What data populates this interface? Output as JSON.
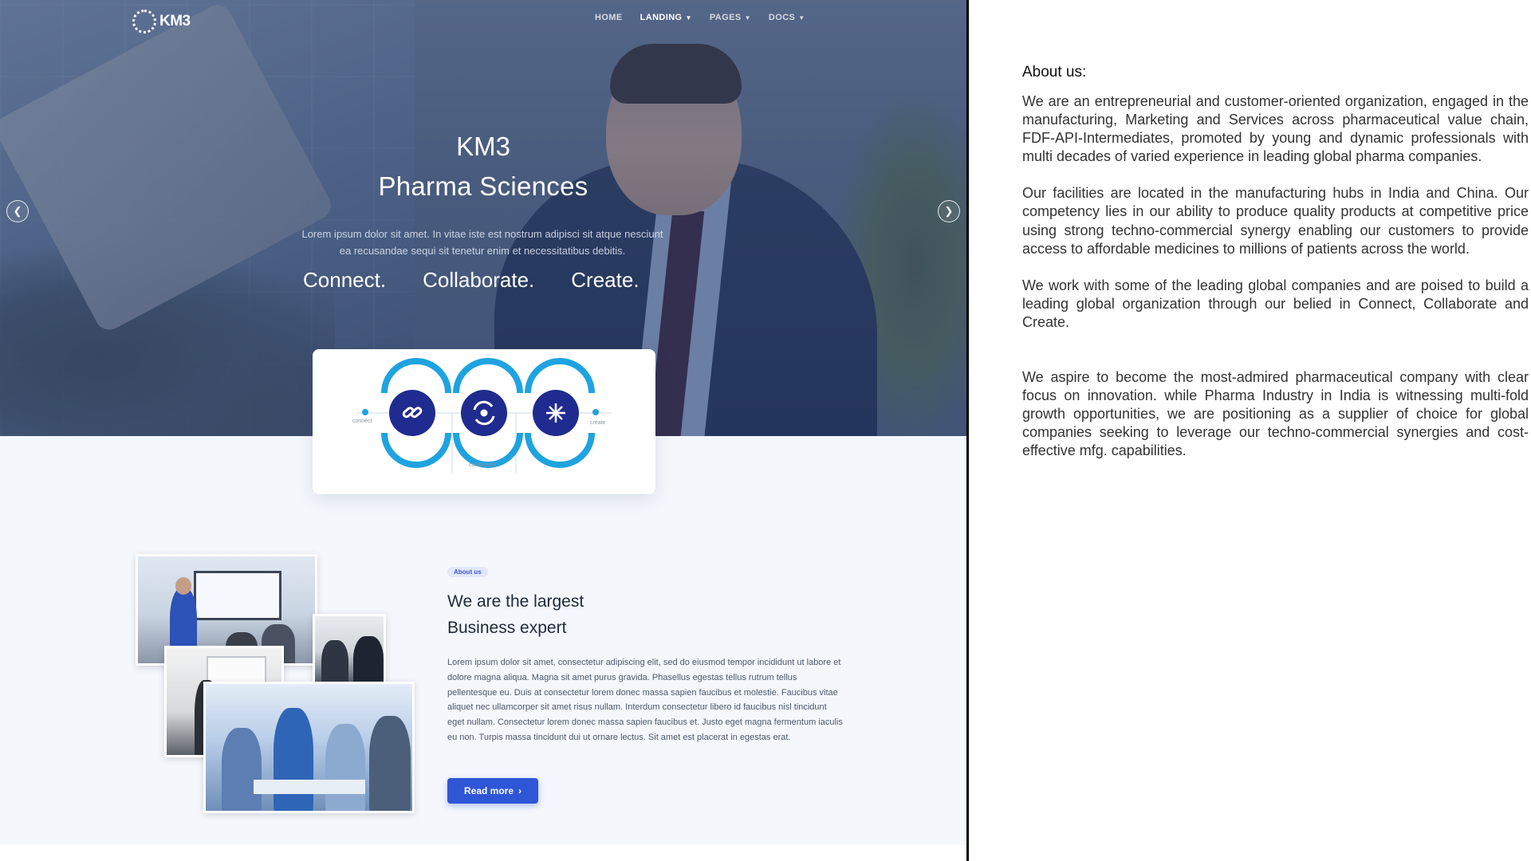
{
  "site": {
    "logo": "KM3",
    "nav": [
      {
        "label": "HOME",
        "has_dropdown": false,
        "active": false
      },
      {
        "label": "LANDING",
        "has_dropdown": true,
        "active": true
      },
      {
        "label": "PAGES",
        "has_dropdown": true,
        "active": false
      },
      {
        "label": "DOCS",
        "has_dropdown": true,
        "active": false
      }
    ],
    "hero": {
      "brand": "KM3",
      "title": "Pharma Sciences",
      "description": "Lorem ipsum dolor sit amet. In vitae iste est nostrum adipisci sit atque nesciunt ea recusandae sequi sit tenetur enim et necessitatibus debitis.",
      "tagline": [
        "Connect.",
        "Collaborate.",
        "Create."
      ],
      "prev_icon": "chevron-left-icon",
      "next_icon": "chevron-right-icon"
    },
    "feature_card": {
      "labels": {
        "left": "connect",
        "middle": "collaborate",
        "right": "create"
      },
      "icons": [
        "chain-link-icon",
        "recycle-arrows-icon",
        "sparkle-icon"
      ],
      "ring_color": "#1fa3e0",
      "circle_color": "#1f2b8f"
    },
    "about": {
      "badge": "About us",
      "heading_line1": "We are the largest",
      "heading_line2": "Business expert",
      "body": "Lorem ipsum dolor sit amet, consectetur adipiscing elit, sed do eiusmod tempor incididunt ut labore et dolore magna aliqua. Magna sit amet purus gravida. Phasellus egestas tellus rutrum tellus pellentesque eu. Duis at consectetur lorem donec massa sapien faucibus et molestie. Faucibus vitae aliquet nec ullamcorper sit amet risus nullam. Interdum consectetur libero id faucibus nisl tincidunt eget nullam. Consectetur lorem donec massa sapien faucibus et. Justo eget magna fermentum iaculis eu non. Turpis massa tincidunt dui ut ornare lectus. Sit amet est placerat in egestas erat.",
      "button_label": "Read more",
      "button_icon": "chevron-right-icon",
      "accent_color": "#2f56d6"
    }
  },
  "about_text": {
    "label": "About us:",
    "paragraphs": [
      "We are an entrepreneurial and customer-oriented organization, engaged in the manufacturing, Marketing and Services across pharmaceutical value chain, FDF-API-Intermediates, promoted by young and dynamic professionals with multi decades of varied experience in leading global pharma companies.",
      "Our facilities are located in the manufacturing hubs in India and China. Our competency lies in our ability to produce quality products at competitive price using strong techno-commercial synergy enabling our customers to provide access to affordable medicines to millions of patients across the world.",
      "We work with some of the leading global companies and are poised to build a leading global organization through our belied in Connect, Collaborate and Create.",
      "We aspire to become the most-admired pharmaceutical company with clear focus on innovation. while Pharma Industry in India is witnessing multi-fold growth opportunities, we are positioning as a supplier of choice for global companies seeking to leverage our techno-commercial synergies and cost-effective mfg. capabilities."
    ]
  }
}
